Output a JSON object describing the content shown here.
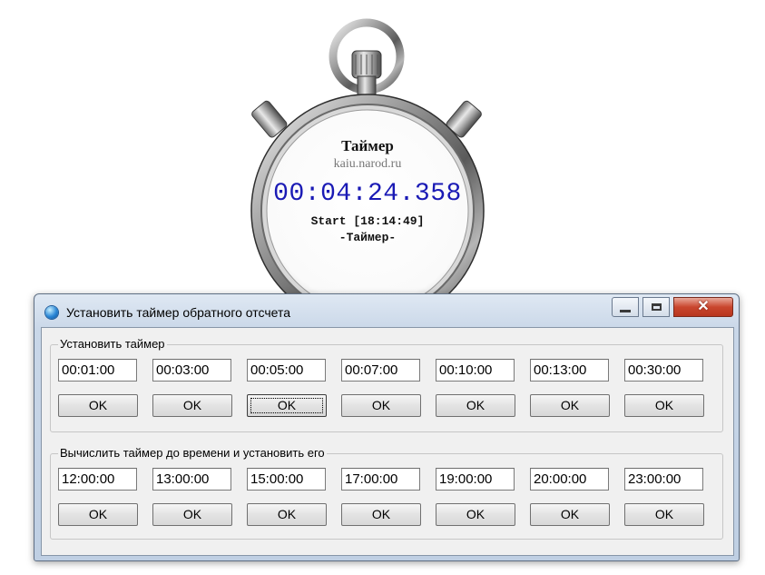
{
  "stopwatch": {
    "title": "Таймер",
    "site": "kaiu.narod.ru",
    "time": "00:04:24.358",
    "start": "Start [18:14:49]",
    "mode": "-Таймер-"
  },
  "window": {
    "title": "Установить таймер обратного отсчета",
    "close_glyph": "✕"
  },
  "group1": {
    "label": "Установить таймер",
    "fields": [
      "00:01:00",
      "00:03:00",
      "00:05:00",
      "00:07:00",
      "00:10:00",
      "00:13:00",
      "00:30:00"
    ],
    "ok_label": "OK"
  },
  "group2": {
    "label": "Вычислить таймер до времени и установить его",
    "fields": [
      "12:00:00",
      "13:00:00",
      "15:00:00",
      "17:00:00",
      "19:00:00",
      "20:00:00",
      "23:00:00"
    ],
    "ok_label": "OK"
  }
}
